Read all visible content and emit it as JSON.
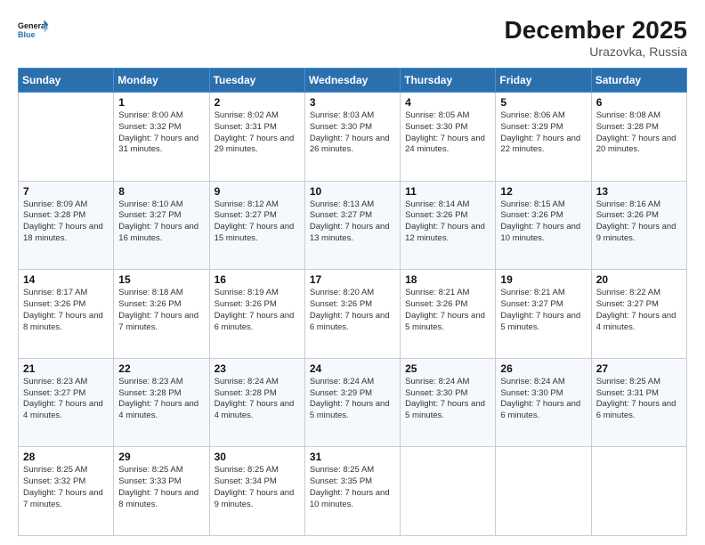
{
  "header": {
    "logo_general": "General",
    "logo_blue": "Blue",
    "month_year": "December 2025",
    "location": "Urazovka, Russia"
  },
  "days_of_week": [
    "Sunday",
    "Monday",
    "Tuesday",
    "Wednesday",
    "Thursday",
    "Friday",
    "Saturday"
  ],
  "weeks": [
    [
      {
        "day": "",
        "sunrise": "",
        "sunset": "",
        "daylight": ""
      },
      {
        "day": "1",
        "sunrise": "Sunrise: 8:00 AM",
        "sunset": "Sunset: 3:32 PM",
        "daylight": "Daylight: 7 hours and 31 minutes."
      },
      {
        "day": "2",
        "sunrise": "Sunrise: 8:02 AM",
        "sunset": "Sunset: 3:31 PM",
        "daylight": "Daylight: 7 hours and 29 minutes."
      },
      {
        "day": "3",
        "sunrise": "Sunrise: 8:03 AM",
        "sunset": "Sunset: 3:30 PM",
        "daylight": "Daylight: 7 hours and 26 minutes."
      },
      {
        "day": "4",
        "sunrise": "Sunrise: 8:05 AM",
        "sunset": "Sunset: 3:30 PM",
        "daylight": "Daylight: 7 hours and 24 minutes."
      },
      {
        "day": "5",
        "sunrise": "Sunrise: 8:06 AM",
        "sunset": "Sunset: 3:29 PM",
        "daylight": "Daylight: 7 hours and 22 minutes."
      },
      {
        "day": "6",
        "sunrise": "Sunrise: 8:08 AM",
        "sunset": "Sunset: 3:28 PM",
        "daylight": "Daylight: 7 hours and 20 minutes."
      }
    ],
    [
      {
        "day": "7",
        "sunrise": "Sunrise: 8:09 AM",
        "sunset": "Sunset: 3:28 PM",
        "daylight": "Daylight: 7 hours and 18 minutes."
      },
      {
        "day": "8",
        "sunrise": "Sunrise: 8:10 AM",
        "sunset": "Sunset: 3:27 PM",
        "daylight": "Daylight: 7 hours and 16 minutes."
      },
      {
        "day": "9",
        "sunrise": "Sunrise: 8:12 AM",
        "sunset": "Sunset: 3:27 PM",
        "daylight": "Daylight: 7 hours and 15 minutes."
      },
      {
        "day": "10",
        "sunrise": "Sunrise: 8:13 AM",
        "sunset": "Sunset: 3:27 PM",
        "daylight": "Daylight: 7 hours and 13 minutes."
      },
      {
        "day": "11",
        "sunrise": "Sunrise: 8:14 AM",
        "sunset": "Sunset: 3:26 PM",
        "daylight": "Daylight: 7 hours and 12 minutes."
      },
      {
        "day": "12",
        "sunrise": "Sunrise: 8:15 AM",
        "sunset": "Sunset: 3:26 PM",
        "daylight": "Daylight: 7 hours and 10 minutes."
      },
      {
        "day": "13",
        "sunrise": "Sunrise: 8:16 AM",
        "sunset": "Sunset: 3:26 PM",
        "daylight": "Daylight: 7 hours and 9 minutes."
      }
    ],
    [
      {
        "day": "14",
        "sunrise": "Sunrise: 8:17 AM",
        "sunset": "Sunset: 3:26 PM",
        "daylight": "Daylight: 7 hours and 8 minutes."
      },
      {
        "day": "15",
        "sunrise": "Sunrise: 8:18 AM",
        "sunset": "Sunset: 3:26 PM",
        "daylight": "Daylight: 7 hours and 7 minutes."
      },
      {
        "day": "16",
        "sunrise": "Sunrise: 8:19 AM",
        "sunset": "Sunset: 3:26 PM",
        "daylight": "Daylight: 7 hours and 6 minutes."
      },
      {
        "day": "17",
        "sunrise": "Sunrise: 8:20 AM",
        "sunset": "Sunset: 3:26 PM",
        "daylight": "Daylight: 7 hours and 6 minutes."
      },
      {
        "day": "18",
        "sunrise": "Sunrise: 8:21 AM",
        "sunset": "Sunset: 3:26 PM",
        "daylight": "Daylight: 7 hours and 5 minutes."
      },
      {
        "day": "19",
        "sunrise": "Sunrise: 8:21 AM",
        "sunset": "Sunset: 3:27 PM",
        "daylight": "Daylight: 7 hours and 5 minutes."
      },
      {
        "day": "20",
        "sunrise": "Sunrise: 8:22 AM",
        "sunset": "Sunset: 3:27 PM",
        "daylight": "Daylight: 7 hours and 4 minutes."
      }
    ],
    [
      {
        "day": "21",
        "sunrise": "Sunrise: 8:23 AM",
        "sunset": "Sunset: 3:27 PM",
        "daylight": "Daylight: 7 hours and 4 minutes."
      },
      {
        "day": "22",
        "sunrise": "Sunrise: 8:23 AM",
        "sunset": "Sunset: 3:28 PM",
        "daylight": "Daylight: 7 hours and 4 minutes."
      },
      {
        "day": "23",
        "sunrise": "Sunrise: 8:24 AM",
        "sunset": "Sunset: 3:28 PM",
        "daylight": "Daylight: 7 hours and 4 minutes."
      },
      {
        "day": "24",
        "sunrise": "Sunrise: 8:24 AM",
        "sunset": "Sunset: 3:29 PM",
        "daylight": "Daylight: 7 hours and 5 minutes."
      },
      {
        "day": "25",
        "sunrise": "Sunrise: 8:24 AM",
        "sunset": "Sunset: 3:30 PM",
        "daylight": "Daylight: 7 hours and 5 minutes."
      },
      {
        "day": "26",
        "sunrise": "Sunrise: 8:24 AM",
        "sunset": "Sunset: 3:30 PM",
        "daylight": "Daylight: 7 hours and 6 minutes."
      },
      {
        "day": "27",
        "sunrise": "Sunrise: 8:25 AM",
        "sunset": "Sunset: 3:31 PM",
        "daylight": "Daylight: 7 hours and 6 minutes."
      }
    ],
    [
      {
        "day": "28",
        "sunrise": "Sunrise: 8:25 AM",
        "sunset": "Sunset: 3:32 PM",
        "daylight": "Daylight: 7 hours and 7 minutes."
      },
      {
        "day": "29",
        "sunrise": "Sunrise: 8:25 AM",
        "sunset": "Sunset: 3:33 PM",
        "daylight": "Daylight: 7 hours and 8 minutes."
      },
      {
        "day": "30",
        "sunrise": "Sunrise: 8:25 AM",
        "sunset": "Sunset: 3:34 PM",
        "daylight": "Daylight: 7 hours and 9 minutes."
      },
      {
        "day": "31",
        "sunrise": "Sunrise: 8:25 AM",
        "sunset": "Sunset: 3:35 PM",
        "daylight": "Daylight: 7 hours and 10 minutes."
      },
      {
        "day": "",
        "sunrise": "",
        "sunset": "",
        "daylight": ""
      },
      {
        "day": "",
        "sunrise": "",
        "sunset": "",
        "daylight": ""
      },
      {
        "day": "",
        "sunrise": "",
        "sunset": "",
        "daylight": ""
      }
    ]
  ]
}
